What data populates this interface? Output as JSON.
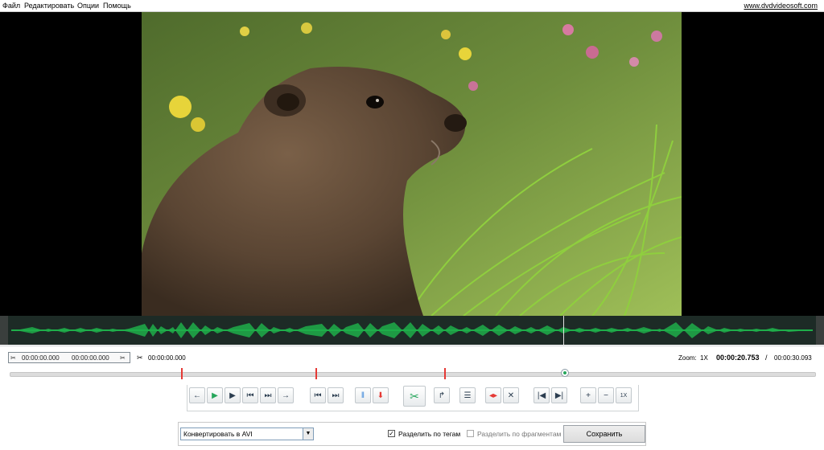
{
  "menu": [
    "Файл",
    "Редактировать",
    "Опции",
    "Помощь"
  ],
  "site_link": "www.dvdvideosoft.com",
  "timecodes": {
    "range_start": "00:00:00.000",
    "range_end": "00:00:00.000",
    "cut_time": "00:00:00.000"
  },
  "zoom": {
    "label": "Zoom:",
    "value": "1X"
  },
  "position": {
    "current": "00:00:20.753",
    "separator": "/",
    "total": "00:00:30.093"
  },
  "timeline": {
    "markers_fraction": [
      0.213,
      0.38,
      0.54
    ],
    "thumb_fraction": 0.69
  },
  "toolbar": {
    "speed_label": "1X"
  },
  "bottom": {
    "format_selected": "Конвертировать в AVI",
    "split_by_tags_label": "Разделить по тегам",
    "split_by_tags_checked": true,
    "split_by_fragments_label": "Разделить по фрагментам",
    "split_by_fragments_checked": false,
    "save_label": "Сохранить"
  },
  "colors": {
    "waveform": "#1fae4a",
    "marker": "#e53935",
    "accent_green": "#26a65b"
  }
}
